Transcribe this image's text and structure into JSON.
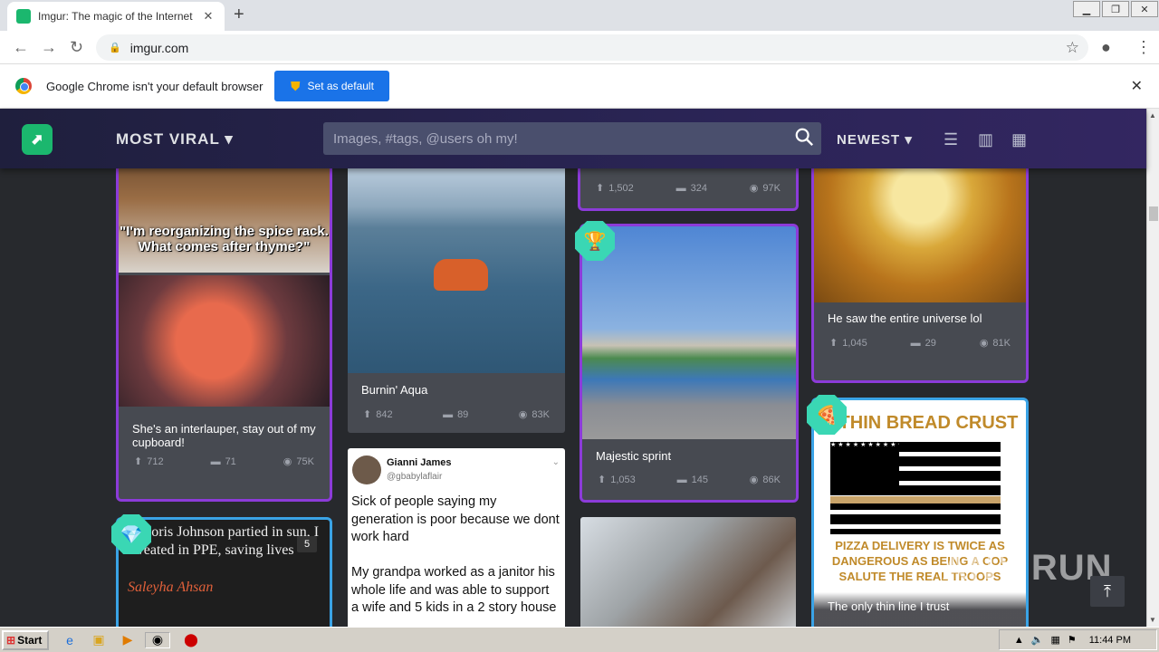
{
  "browser": {
    "tab_title": "Imgur: The magic of the Internet",
    "url": "imgur.com",
    "infobar_message": "Google Chrome isn't your default browser",
    "set_default_label": "Set as default"
  },
  "imgur": {
    "section_label": "MOST VIRAL",
    "search_placeholder": "Images, #tags, @users oh my!",
    "sort_label": "NEWEST"
  },
  "posts": [
    {
      "title": "She's an interlauper, stay out of my cupboard!",
      "upvotes": "712",
      "comments": "71",
      "views": "75K",
      "image_text": "\"I'm reorganizing the spice rack. What comes after thyme?\""
    },
    {
      "title": "Burnin' Aqua",
      "upvotes": "842",
      "comments": "89",
      "views": "83K"
    },
    {
      "title": "",
      "upvotes": "1,502",
      "comments": "324",
      "views": "97K"
    },
    {
      "title": "Majestic sprint",
      "upvotes": "1,053",
      "comments": "145",
      "views": "86K"
    },
    {
      "title": "He saw the entire universe lol",
      "upvotes": "1,045",
      "comments": "29",
      "views": "81K"
    },
    {
      "title": "The only thin line I trust",
      "image_top": "E THIN BREAD CRUST",
      "image_bottom": "PIZZA DELIVERY IS TWICE AS DANGEROUS AS BEING A COP SALUTE THE REAL TROOPS"
    },
    {
      "image_text": "le Boris Johnson partied in sun, I sweated in PPE, saving lives",
      "author": "Saleyha Ahsan",
      "count": "5"
    },
    {
      "tweet_name": "Gianni James",
      "tweet_handle": "@gbabylaflair",
      "tweet_text": "Sick of people saying my generation is poor because we dont work hard\n\nMy grandpa worked as a janitor his whole life and was able to support a wife and 5 kids in a 2 story house"
    }
  ],
  "taskbar": {
    "start_label": "Start",
    "clock": "11:44 PM"
  },
  "watermark": "ANY RUN"
}
